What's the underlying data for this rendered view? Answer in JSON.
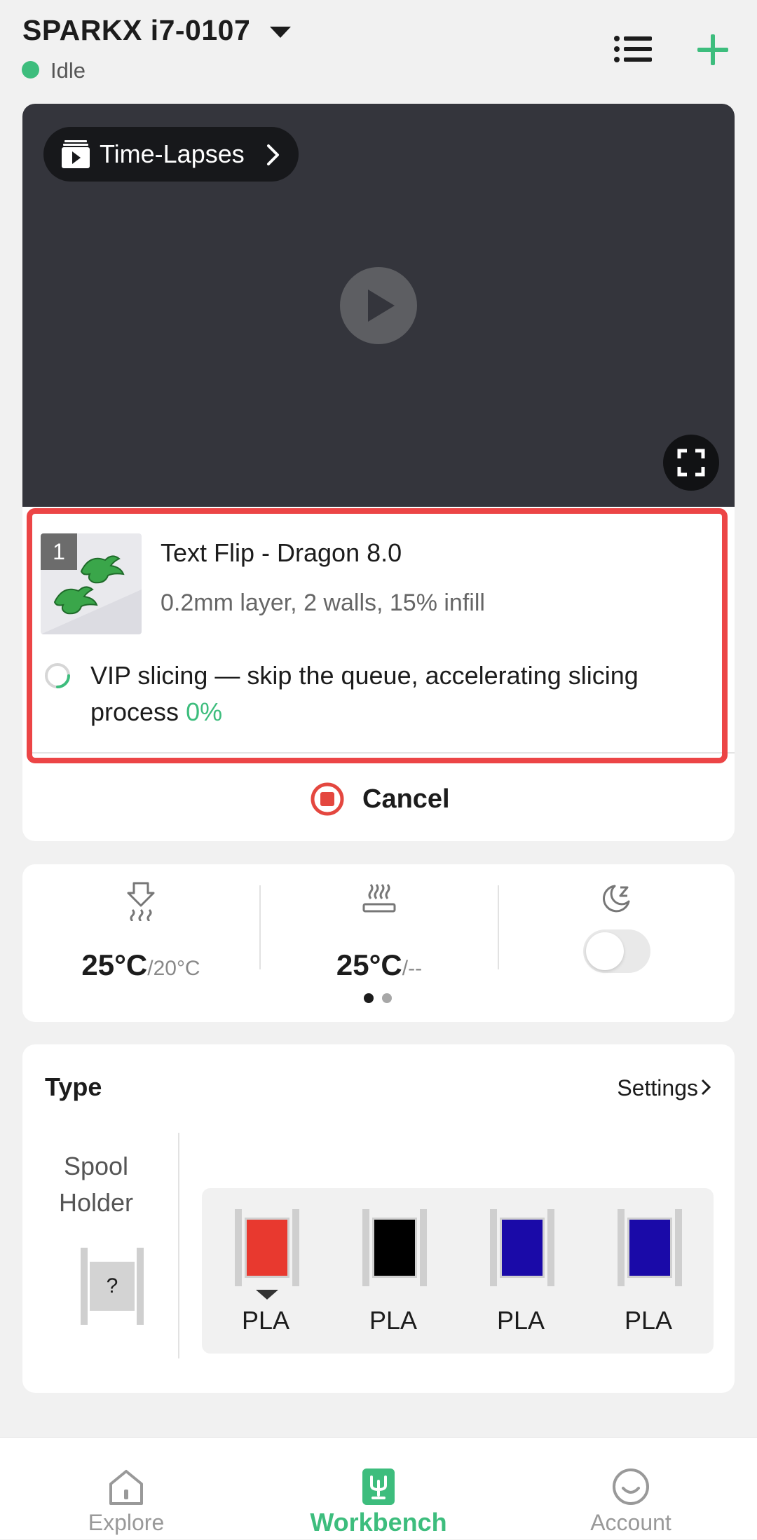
{
  "header": {
    "device_name": "SPARKX i7-0107",
    "status": "Idle",
    "status_color": "#3dbd7d",
    "icons": [
      "chevron-down-icon",
      "list-icon",
      "plus-icon"
    ]
  },
  "video": {
    "timelapse_label": "Time-Lapses",
    "icons": [
      "timelapse-icon",
      "chevron-right-icon",
      "play-icon",
      "fullscreen-icon"
    ]
  },
  "job": {
    "plate_number": "1",
    "title": "Text Flip - Dragon 8.0",
    "details": "0.2mm layer, 2 walls, 15% infill",
    "slicing_text": "VIP slicing — skip the queue, accelerating slicing process",
    "slicing_progress": "0%",
    "cancel_label": "Cancel",
    "highlight_color": "#ec4546"
  },
  "temperatures": {
    "nozzle": {
      "current": "25°C",
      "target": "/20°C",
      "icon": "nozzle-heat-icon"
    },
    "bed": {
      "current": "25°C",
      "target": "/--",
      "icon": "bed-heat-icon"
    },
    "sleep": {
      "icon": "sleep-moon-icon",
      "enabled": false
    },
    "page": {
      "current": 1,
      "total": 2
    }
  },
  "filament": {
    "title": "Type",
    "settings_label": "Settings",
    "spool_holder_label": "Spool Holder",
    "spool_holder_value": "?",
    "slots": [
      {
        "label": "PLA",
        "color": "#e8392f",
        "active": true
      },
      {
        "label": "PLA",
        "color": "#000000",
        "active": false
      },
      {
        "label": "PLA",
        "color": "#1a0aa8",
        "active": false
      },
      {
        "label": "PLA",
        "color": "#1a0aa8",
        "active": false
      }
    ]
  },
  "nav": {
    "explore": "Explore",
    "workbench": "Workbench",
    "account": "Account",
    "active": "Workbench",
    "accent_color": "#3dbd7d"
  }
}
